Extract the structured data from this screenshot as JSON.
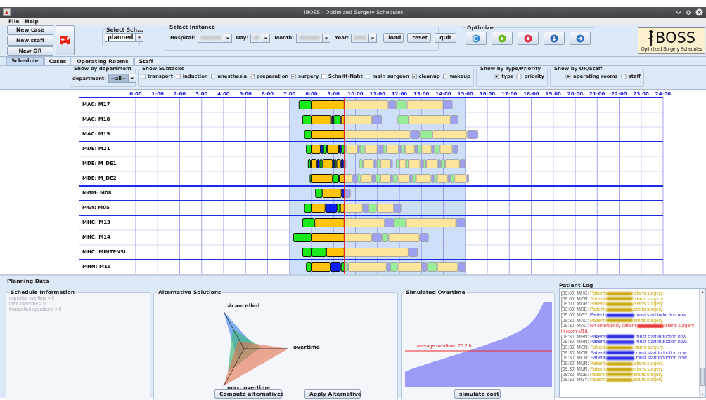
{
  "window": {
    "title": "IBOSS - Optimized Surgery Schedules"
  },
  "menu": [
    "File",
    "Help"
  ],
  "toolbar": {
    "new_buttons": [
      "New case",
      "New staff",
      "New OR"
    ],
    "schedule_select": {
      "title": "Select Sch...",
      "value": "planned"
    },
    "instance": {
      "title": "Select Instance",
      "fields": [
        {
          "label": "Hospital:",
          "kind": "wide"
        },
        {
          "label": "Day:",
          "kind": "narrow"
        },
        {
          "label": "Month:",
          "kind": "wide"
        },
        {
          "label": "Year:",
          "kind": "medium"
        }
      ],
      "buttons": [
        "load",
        "reset",
        "quit"
      ]
    },
    "optimize": {
      "title": "Optimize",
      "buttons": [
        {
          "kind": "refresh"
        },
        {
          "kind": "play"
        },
        {
          "kind": "stop"
        },
        {
          "kind": "download"
        },
        {
          "kind": "forward"
        }
      ]
    },
    "logo": {
      "text": "BOSS",
      "subtitle": "Optimized Surgery Schedules"
    }
  },
  "tabs": [
    {
      "label": "Schedule",
      "selected": true
    },
    {
      "label": "Cases",
      "selected": false
    },
    {
      "label": "Operating Rooms",
      "selected": false
    },
    {
      "label": "Staff",
      "selected": false
    }
  ],
  "filters": {
    "department": {
      "title": "Show by department",
      "label": "department:",
      "value": "--all--"
    },
    "subtasks": {
      "title": "Show Subtasks",
      "items": [
        {
          "label": "transport",
          "checked": false
        },
        {
          "label": "induction",
          "checked": false
        },
        {
          "label": "anesthesia",
          "checked": false
        },
        {
          "label": "preparation",
          "checked": true
        },
        {
          "label": "surgery",
          "checked": true
        },
        {
          "label": "Schnitt-Naht",
          "checked": false
        },
        {
          "label": "main surgeon",
          "checked": false
        },
        {
          "label": "cleanup",
          "checked": true
        },
        {
          "label": "wakeup",
          "checked": false
        }
      ]
    },
    "type_priority": {
      "title": "Show by Type/Priority",
      "options": [
        {
          "label": "type",
          "selected": true
        },
        {
          "label": "priority",
          "selected": false
        }
      ]
    },
    "or_staff": {
      "title": "Show by OR/Staff",
      "options": [
        {
          "label": "operating rooms",
          "selected": true
        },
        {
          "label": "staff",
          "selected": false
        }
      ]
    }
  },
  "schedule": {
    "hours": [
      "0:00",
      "1:00",
      "2:00",
      "3:00",
      "4:00",
      "5:00",
      "6:00",
      "7:00",
      "8:00",
      "9:00",
      "10:00",
      "11:00",
      "12:00",
      "13:00",
      "14:00",
      "15:00",
      "16:00",
      "17:00",
      "18:00",
      "19:00",
      "20:00",
      "21:00",
      "22:00",
      "23:00",
      "24:00"
    ],
    "groups": [
      {
        "rooms": [
          "MAC: M17",
          "MAC: M18",
          "MAC: M19"
        ]
      },
      {
        "rooms": [
          "MDE: M21",
          "MDE: M_DE1",
          "MDE: M_DE2"
        ]
      },
      {
        "rooms": [
          "MGM: M08"
        ]
      },
      {
        "rooms": [
          "MGY: M05"
        ]
      },
      {
        "rooms": [
          "MHC: M13",
          "MHC: M14",
          "MHC: MINTENSI"
        ]
      },
      {
        "rooms": [
          "MHN: M15"
        ]
      }
    ]
  },
  "planning": {
    "title": "Planning Data",
    "schedule_information": {
      "title": "Schedule Information",
      "lines": [
        "expected overtime = 0",
        "max. overtime = 0",
        "#cancelled operations = 0"
      ]
    },
    "alternatives": {
      "title": "Alternative Solutions",
      "axes": [
        "#cancelled",
        "overtime",
        "max. overtime"
      ],
      "buttons": [
        "Compute alternatives",
        "Apply Alternative"
      ]
    },
    "simulated_overtime": {
      "title": "Simulated Overtime",
      "average_label": "average overtime: 70.2 h",
      "button": "simulate cost"
    }
  },
  "patient_log": {
    "title": "Patient Log",
    "entries": [
      {
        "prefix": "[09:00] MHC:",
        "kind": "surgery",
        "before": "Patient",
        "after": "starts surgery."
      },
      {
        "prefix": "[09:00] MOR:",
        "kind": "surgery",
        "before": "Patient",
        "after": "starts surgery."
      },
      {
        "prefix": "[09:00] MUR:",
        "kind": "surgery",
        "before": "Patient",
        "after": "starts surgery."
      },
      {
        "prefix": "[09:00] MDE:",
        "kind": "surgery",
        "before": "Patient",
        "after": "starts surgery."
      },
      {
        "prefix": "[09:00] MGY:",
        "kind": "induction",
        "before": "Patient",
        "after": "must start induction now."
      },
      {
        "prefix": "[09:30] MAC:",
        "kind": "surgery",
        "before": "Patient",
        "after": "starts surgery."
      },
      {
        "prefix": "[09:30] MAC:",
        "kind": "emergency",
        "before": "N4 emergency patient",
        "after": "starts surgery in room M18."
      },
      {
        "prefix": "[09:30] MHN:",
        "kind": "induction",
        "before": "Patient",
        "after": "must start induction now."
      },
      {
        "prefix": "[09:30] MHN:",
        "kind": "induction",
        "before": "Patient",
        "after": "must start induction now."
      },
      {
        "prefix": "[09:30] MOR:",
        "kind": "surgery",
        "before": "Patient",
        "after": "starts surgery."
      },
      {
        "prefix": "[09:30] MOR:",
        "kind": "induction",
        "before": "Patient",
        "after": "must start induction now."
      },
      {
        "prefix": "[09:30] MOR:",
        "kind": "induction",
        "before": "Patient",
        "after": "must start induction now."
      },
      {
        "prefix": "[09:30] MUR:",
        "kind": "surgery",
        "before": "Patient",
        "after": "starts surgery."
      },
      {
        "prefix": "[09:30] MUR:",
        "kind": "surgery",
        "before": "Patient",
        "after": "starts surgery."
      },
      {
        "prefix": "[09:30] MDE:",
        "kind": "surgery",
        "before": "Patient",
        "after": "starts surgery."
      },
      {
        "prefix": "[09:30] MGY:",
        "kind": "surgery",
        "before": "Patient",
        "after": "starts surgery."
      }
    ]
  }
}
